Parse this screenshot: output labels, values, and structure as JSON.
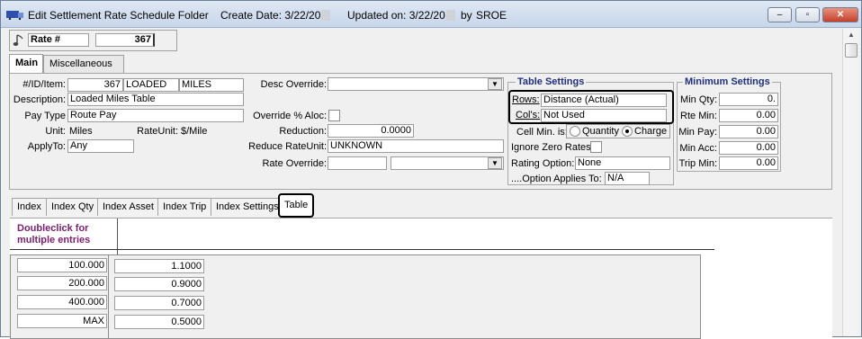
{
  "window": {
    "title": "Edit Settlement Rate Schedule Folder",
    "create_label": "Create Date: 3/22/20",
    "updated_label": "Updated on: 3/22/20",
    "by_label": "by",
    "user": "SROE",
    "buttons": {
      "minimize": "–",
      "restore": "▫",
      "close": "✕"
    }
  },
  "header": {
    "rate_label": "Rate #",
    "rate_value": "367"
  },
  "main_tabs": [
    "Main",
    "Miscellaneous"
  ],
  "left_fields": {
    "id_item_label": "#/ID/Item:",
    "id_value": "367",
    "item_value": "LOADED",
    "item_unit_value": "MILES",
    "description_label": "Description:",
    "description_value": "Loaded Miles Table",
    "pay_type_label": "Pay Type",
    "pay_type_value": "Route Pay",
    "unit_label": "Unit:",
    "unit_value": "Miles",
    "rate_unit_label": "RateUnit:",
    "rate_unit_value": "$/Mile",
    "apply_to_label": "ApplyTo:",
    "apply_to_value": "Any"
  },
  "middle_fields": {
    "desc_override_label": "Desc Override:",
    "desc_override_value": "",
    "override_aloc_label": "Override % Aloc:",
    "reduction_label": "Reduction:",
    "reduction_value": "0.0000",
    "reduce_rate_unit_label": "Reduce RateUnit:",
    "reduce_rate_unit_value": "UNKNOWN",
    "rate_override_label": "Rate Override:",
    "rate_override_value": "",
    "rate_override_select": ""
  },
  "table_settings": {
    "title": "Table Settings",
    "rows_label": "Rows:",
    "rows_value": "Distance (Actual)",
    "cols_label": "Col's:",
    "cols_value": "Not Used",
    "cell_min_label": "Cell Min. is:",
    "radio_quantity": "Quantity",
    "radio_charge": "Charge",
    "selected_radio": "Charge",
    "ignore_zero_label": "Ignore Zero Rates",
    "rating_option_label": "Rating Option:",
    "rating_option_value": "None",
    "option_applies_label": "....Option Applies To:",
    "option_applies_value": "N/A"
  },
  "minimum_settings": {
    "title": "Minimum Settings",
    "min_qty_label": "Min Qty:",
    "min_qty_value": "0.",
    "rte_min_label": "Rte Min:",
    "rte_min_value": "0.00",
    "min_pay_label": "Min Pay:",
    "min_pay_value": "0.00",
    "min_acc_label": "Min Acc:",
    "min_acc_value": "0.00",
    "trip_min_label": "Trip Min:",
    "trip_min_value": "0.00"
  },
  "sub_tabs": [
    "Index",
    "Index Qty",
    "Index Asset",
    "Index Trip",
    "Index Settings",
    "Table"
  ],
  "active_sub_tab": "Table",
  "table": {
    "header_line1": "Doubleclick for",
    "header_line2": "multiple entries",
    "rows": [
      {
        "key": "100.000",
        "rate": "1.1000"
      },
      {
        "key": "200.000",
        "rate": "0.9000"
      },
      {
        "key": "400.000",
        "rate": "0.7000"
      },
      {
        "key": "MAX",
        "rate": "0.5000"
      }
    ]
  },
  "colors": {
    "group_title": "#1f2f7a",
    "table_header": "#7a1f6e"
  }
}
